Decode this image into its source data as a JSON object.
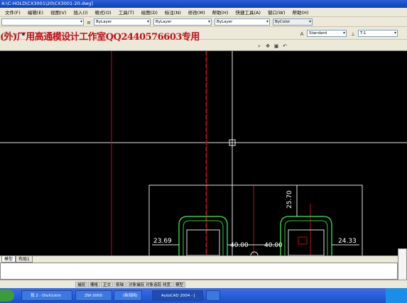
{
  "window": {
    "title": "A:\\C-HOLD\\CX3001\\20\\CX3001-20.dwg]"
  },
  "menu": [
    "文件(F)",
    "编辑(E)",
    "视图(V)",
    "插入(I)",
    "格式(O)",
    "工具(T)",
    "绘图(D)",
    "标注(N)",
    "修改(M)",
    "帮助(H)",
    "快捷工具(A)",
    "窗口(W)",
    "帮助(H)"
  ],
  "toolbar": {
    "layer_combo": "ByLayer",
    "linetype_combo": "ByLayer",
    "lineweight_combo": "ByLayer",
    "plotstyle_combo": "ByColor",
    "textstyle_combo": "Standard",
    "dimstyle_combo": "T-1"
  },
  "watermark": "(外)厂用高通模设计工作室QQ2440576603专用",
  "drawing": {
    "dimensions": [
      "25.70",
      "23.69",
      "40.00",
      "40.00",
      "24.33"
    ]
  },
  "tabs": [
    "模型",
    "布局1"
  ],
  "status": [
    "捕捉",
    "栅格",
    "正交",
    "极轴",
    "对象捕捉",
    "对象追踪",
    "线宽",
    "模型"
  ],
  "taskbar": {
    "items": [
      "我 2 - DivX/ukm",
      "ZW-3000",
      "(新闻网)",
      "AutoCAD 2004 - [",
      ""
    ]
  }
}
